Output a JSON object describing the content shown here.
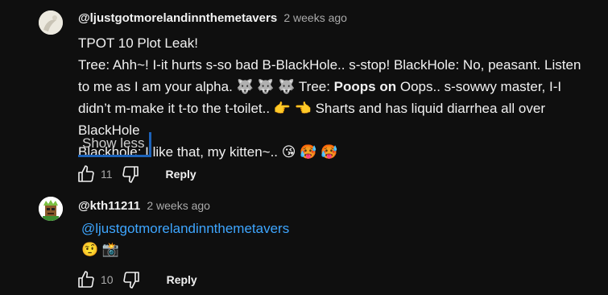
{
  "comments": [
    {
      "author": "@ljustgotmorelandinnthemetavers",
      "time": "2 weeks ago",
      "lines": [
        "TPOT 10 Plot Leak!",
        "Tree: Ahh~! I-it hurts s-so bad B-BlackHole.. s-stop! BlackHole: No, peasant. Listen to me as I am your alpha. 🐺 🐺 🐺 Tree: ",
        "Poops on",
        " Oops.. s-sowwy master, I-I didn’t m-make it t-to the t-toilet.. 👉 👈 Sharts and has liquid diarrhea all over BlackHole",
        "Blackhole: I like that, my kitten~.. 😘 🥵 🥵"
      ],
      "show_less": "Show less",
      "likes": "11",
      "reply": "Reply"
    },
    {
      "author": "@kth11211",
      "time": "2 weeks ago",
      "mention": "@ljustgotmorelandinnthemetavers",
      "emoji_line": "🤨 📸",
      "likes": "10",
      "reply": "Reply"
    }
  ],
  "icons": {
    "like": "thumbs-up-icon",
    "dislike": "thumbs-down-icon"
  }
}
